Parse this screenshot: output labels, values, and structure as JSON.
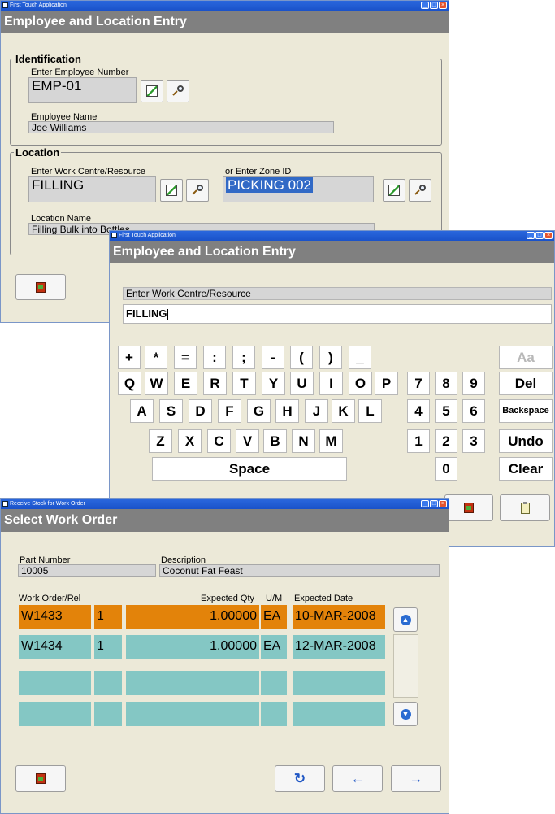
{
  "window1": {
    "title": "First Touch Application",
    "header": "Employee and Location Entry",
    "identification": {
      "legend": "Identification",
      "employee_number_label": "Enter Employee Number",
      "employee_number_value": "EMP-01",
      "employee_name_label": "Employee Name",
      "employee_name_value": "Joe Williams"
    },
    "location": {
      "legend": "Location",
      "work_centre_label": "Enter Work Centre/Resource",
      "work_centre_value": "FILLING",
      "zone_label": "or Enter Zone ID",
      "zone_value": "PICKING 002",
      "location_name_label": "Location Name",
      "location_name_value": "Filling Bulk into Bottles"
    }
  },
  "window2": {
    "title": "First Touch Application",
    "header": "Employee and Location Entry",
    "prompt": "Enter Work Centre/Resource",
    "input_value": "FILLING",
    "symbol_keys": [
      "+",
      "*",
      "=",
      ":",
      ";",
      "-",
      "(",
      ")",
      "_"
    ],
    "row1_keys": [
      "Q",
      "W",
      "E",
      "R",
      "T",
      "Y",
      "U",
      "I",
      "O",
      "P"
    ],
    "row2_keys": [
      "A",
      "S",
      "D",
      "F",
      "G",
      "H",
      "J",
      "K",
      "L"
    ],
    "row3_keys": [
      "Z",
      "X",
      "C",
      "V",
      "B",
      "N",
      "M"
    ],
    "space_label": "Space",
    "numpad": [
      "7",
      "8",
      "9",
      "4",
      "5",
      "6",
      "1",
      "2",
      "3",
      "0"
    ],
    "aa_label": "Aa",
    "del_label": "Del",
    "backspace_label": "Backspace",
    "undo_label": "Undo",
    "clear_label": "Clear"
  },
  "window3": {
    "title": "Receive Stock for Work Order",
    "header": "Select Work Order",
    "part_number_label": "Part Number",
    "part_number_value": "10005",
    "description_label": "Description",
    "description_value": "Coconut Fat Feast",
    "columns": {
      "work_order": "Work Order/Rel",
      "expected_qty": "Expected Qty",
      "um": "U/M",
      "expected_date": "Expected Date"
    },
    "rows": [
      {
        "work_order": "W1433",
        "rel": "1",
        "qty": "1.00000",
        "um": "EA",
        "date": "10-MAR-2008"
      },
      {
        "work_order": "W1434",
        "rel": "1",
        "qty": "1.00000",
        "um": "EA",
        "date": "12-MAR-2008"
      },
      {
        "work_order": "",
        "rel": "",
        "qty": "",
        "um": "",
        "date": ""
      },
      {
        "work_order": "",
        "rel": "",
        "qty": "",
        "um": "",
        "date": ""
      }
    ]
  },
  "colors": {
    "titlebar": "#2a67dd",
    "header_bar": "#808080",
    "window_bg": "#ece9d8",
    "row_selected": "#e3830a",
    "row_normal": "#84c7c4"
  },
  "icons": {
    "titlebar": [
      "minimize-icon",
      "maximize-icon",
      "close-icon"
    ],
    "edit": "pencil-edit-icon",
    "search": "magnifier-icon",
    "exit": "exit-door-icon",
    "clipboard": "clipboard-icon",
    "refresh": "refresh-icon",
    "prev": "arrow-left-icon",
    "next": "arrow-right-icon",
    "scroll_up": "scroll-up-icon",
    "scroll_down": "scroll-down-icon"
  }
}
